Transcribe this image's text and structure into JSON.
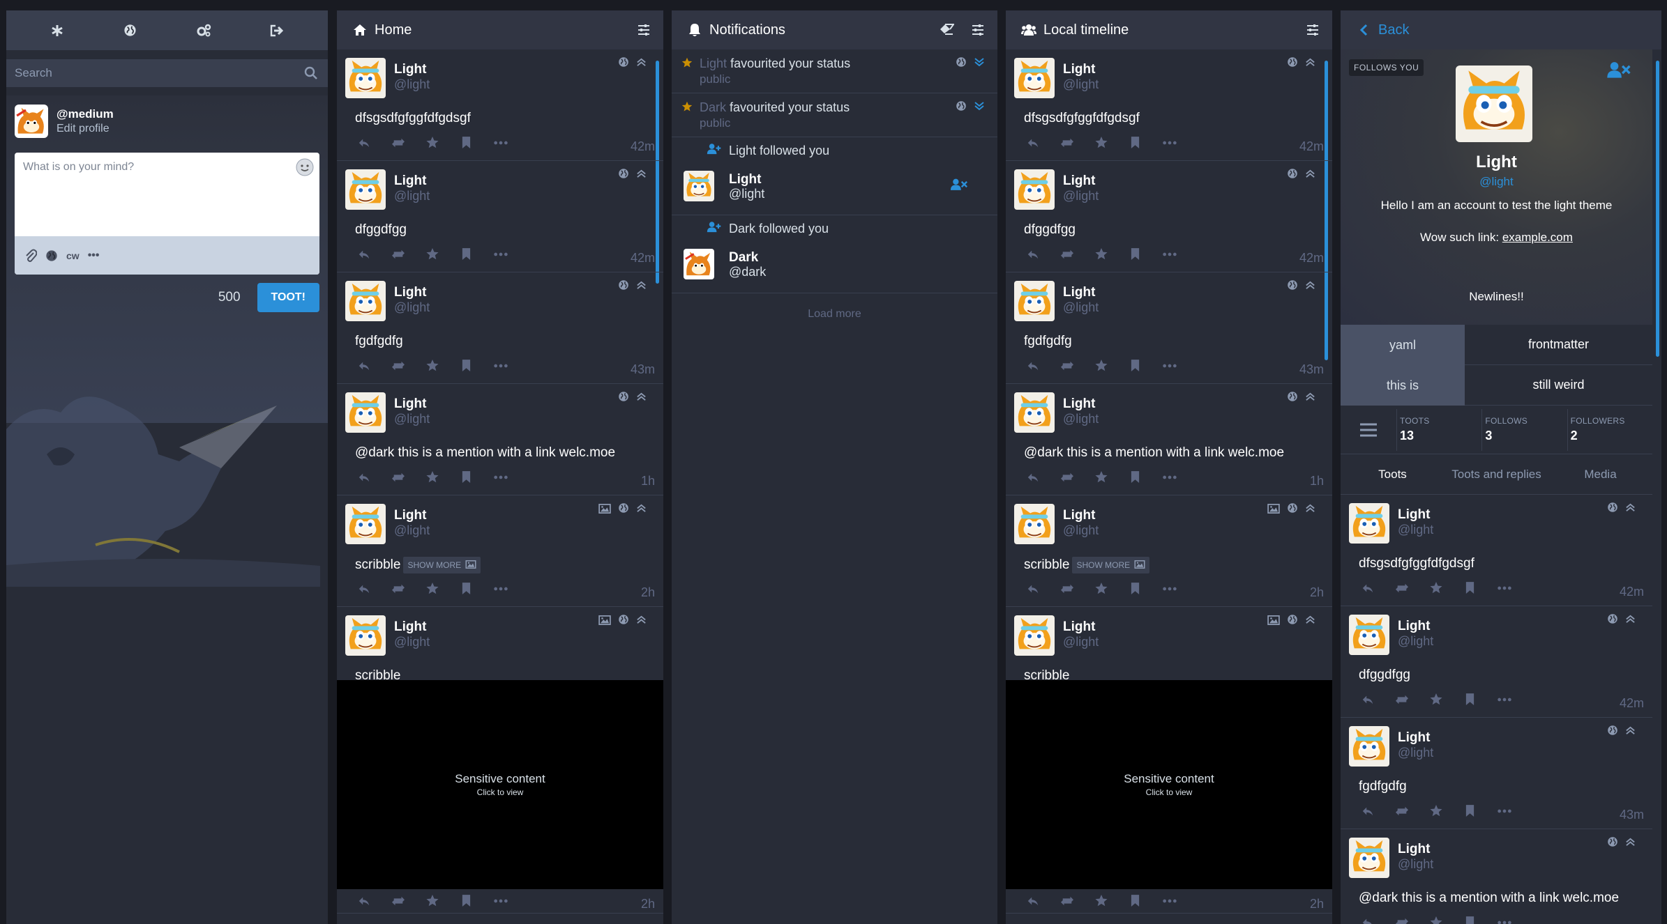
{
  "nav": {
    "icons": [
      "getting-started",
      "federated-timeline",
      "preferences",
      "logout"
    ]
  },
  "search": {
    "placeholder": "Search"
  },
  "me": {
    "handle": "@medium",
    "edit_label": "Edit profile"
  },
  "compose": {
    "placeholder": "What is on your mind?",
    "cw_label": "cw",
    "more_label": "•••",
    "char_count": "500",
    "toot_label": "TOOT!"
  },
  "columns": {
    "home": {
      "title": "Home"
    },
    "notifications": {
      "title": "Notifications",
      "load_more": "Load more"
    },
    "local": {
      "title": "Local timeline"
    },
    "profile": {
      "back_label": "Back"
    }
  },
  "statuses": [
    {
      "name": "Light",
      "acct": "@light",
      "content": "dfsgsdfgfggfdfgdsgf",
      "time": "42m",
      "has_media_icon": false
    },
    {
      "name": "Light",
      "acct": "@light",
      "content": "dfggdfgg",
      "time": "42m",
      "has_media_icon": false
    },
    {
      "name": "Light",
      "acct": "@light",
      "content": "fgdfgdfg",
      "time": "43m",
      "has_media_icon": false
    },
    {
      "name": "Light",
      "acct": "@light",
      "content": "@dark this is a mention with a link welc.moe",
      "time": "1h",
      "has_media_icon": false
    },
    {
      "name": "Light",
      "acct": "@light",
      "content": "scribble",
      "time": "2h",
      "has_media_icon": true,
      "show_more": "SHOW MORE"
    },
    {
      "name": "Light",
      "acct": "@light",
      "content": "scribble",
      "time": "2h",
      "has_media_icon": true,
      "sensitive_title": "Sensitive content",
      "sensitive_sub": "Click to view"
    }
  ],
  "notifications": {
    "fav1": {
      "who": "Light",
      "text": "favourited your status",
      "sub": "public"
    },
    "fav2": {
      "who": "Dark",
      "text": "favourited your status",
      "sub": "public"
    },
    "follow1": {
      "header": "Light followed you",
      "name": "Light",
      "acct": "@light"
    },
    "follow2": {
      "header": "Dark followed you",
      "name": "Dark",
      "acct": "@dark"
    }
  },
  "profile": {
    "follows_you": "FOLLOWS YOU",
    "name": "Light",
    "acct": "@light",
    "bio": "Hello I am an account to test the light theme",
    "link_prefix": "Wow such link: ",
    "link_text": "example.com",
    "bio_last": "Newlines!!",
    "fields": [
      {
        "key": "yaml",
        "value": "frontmatter"
      },
      {
        "key": "this is",
        "value": "still weird"
      }
    ],
    "counters": [
      {
        "label": "TOOTS",
        "value": "13"
      },
      {
        "label": "FOLLOWS",
        "value": "3"
      },
      {
        "label": "FOLLOWERS",
        "value": "2"
      }
    ],
    "tabs": [
      "Toots",
      "Toots and replies",
      "Media"
    ],
    "statuses": [
      {
        "name": "Light",
        "acct": "@light",
        "content": "dfsgsdfgfggfdfgdsgf",
        "time": "42m"
      },
      {
        "name": "Light",
        "acct": "@light",
        "content": "dfggdfgg",
        "time": "42m"
      },
      {
        "name": "Light",
        "acct": "@light",
        "content": "fgdfgdfg",
        "time": "43m"
      },
      {
        "name": "Light",
        "acct": "@light",
        "content": "@dark this is a mention with a link welc.moe",
        "time": ""
      }
    ]
  },
  "colors": {
    "accent": "#2b90d9",
    "star": "#ca8f04",
    "bg": "#191b22",
    "column": "#282c37"
  }
}
